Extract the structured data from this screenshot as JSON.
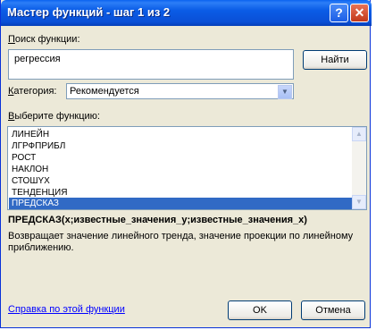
{
  "window": {
    "title": "Мастер функций - шаг 1 из 2",
    "help_glyph": "?",
    "close_glyph": "✕"
  },
  "search": {
    "label": "Поиск функции:",
    "value": "регрессия",
    "find_button": "Найти"
  },
  "category": {
    "label": "Категория:",
    "selected": "Рекомендуется"
  },
  "functions": {
    "label": "Выберите функцию:",
    "items": [
      "ЛИНЕЙН",
      "ЛГРФПРИБЛ",
      "РОСТ",
      "НАКЛОН",
      "СТОШYX",
      "ТЕНДЕНЦИЯ",
      "ПРЕДСКАЗ"
    ],
    "selected_index": 6
  },
  "description": {
    "signature": "ПРЕДСКАЗ(x;известные_значения_y;известные_значения_x)",
    "text": "Возвращает значение линейного тренда, значение проекции по линейному приближению."
  },
  "footer": {
    "help_link": "Справка по этой функции",
    "ok_button": "OK",
    "cancel_button": "Отмена"
  }
}
